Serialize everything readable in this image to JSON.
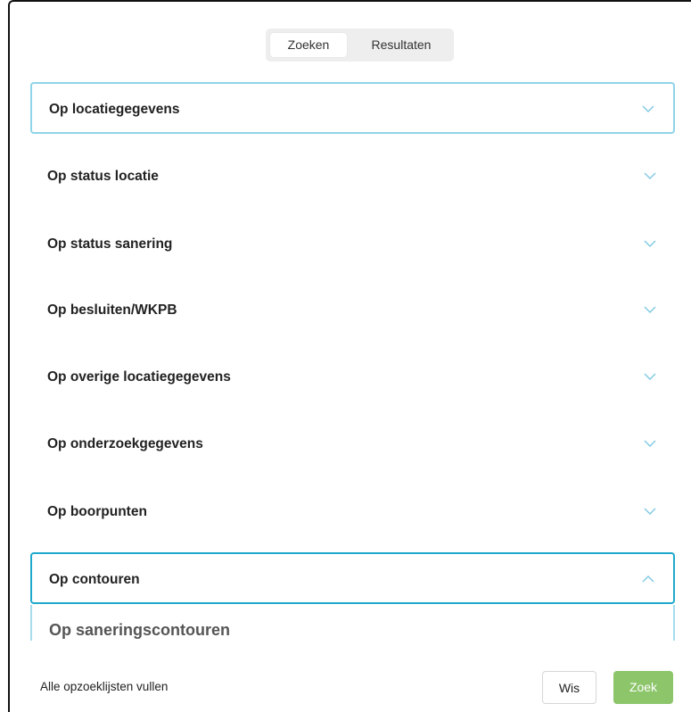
{
  "tabs": [
    {
      "label": "Zoeken",
      "active": true
    },
    {
      "label": "Resultaten",
      "active": false
    }
  ],
  "sections": [
    {
      "label": "Op locatiegegevens",
      "expanded": false,
      "state": "focused"
    },
    {
      "label": "Op status locatie",
      "expanded": false,
      "state": "default"
    },
    {
      "label": "Op status sanering",
      "expanded": false,
      "state": "default"
    },
    {
      "label": "Op besluiten/WKPB",
      "expanded": false,
      "state": "default"
    },
    {
      "label": "Op overige locatiegegevens",
      "expanded": false,
      "state": "default"
    },
    {
      "label": "Op onderzoekgegevens",
      "expanded": false,
      "state": "default"
    },
    {
      "label": "Op boorpunten",
      "expanded": false,
      "state": "default"
    },
    {
      "label": "Op contouren",
      "expanded": true,
      "state": "active"
    }
  ],
  "expanded_panel": {
    "subheading": "Op saneringscontouren"
  },
  "footer": {
    "fill_label": "Alle opzoeklijsten vullen",
    "clear_label": "Wis",
    "search_label": "Zoek"
  },
  "colors": {
    "chevron": "#7ec8e3",
    "focus_border_light": "#8fd4e8",
    "focus_border_dark": "#1ea9cc",
    "search_button": "#8cc56a"
  },
  "icons": {
    "collapsed": "chevron-down-icon",
    "expanded": "chevron-up-icon"
  }
}
